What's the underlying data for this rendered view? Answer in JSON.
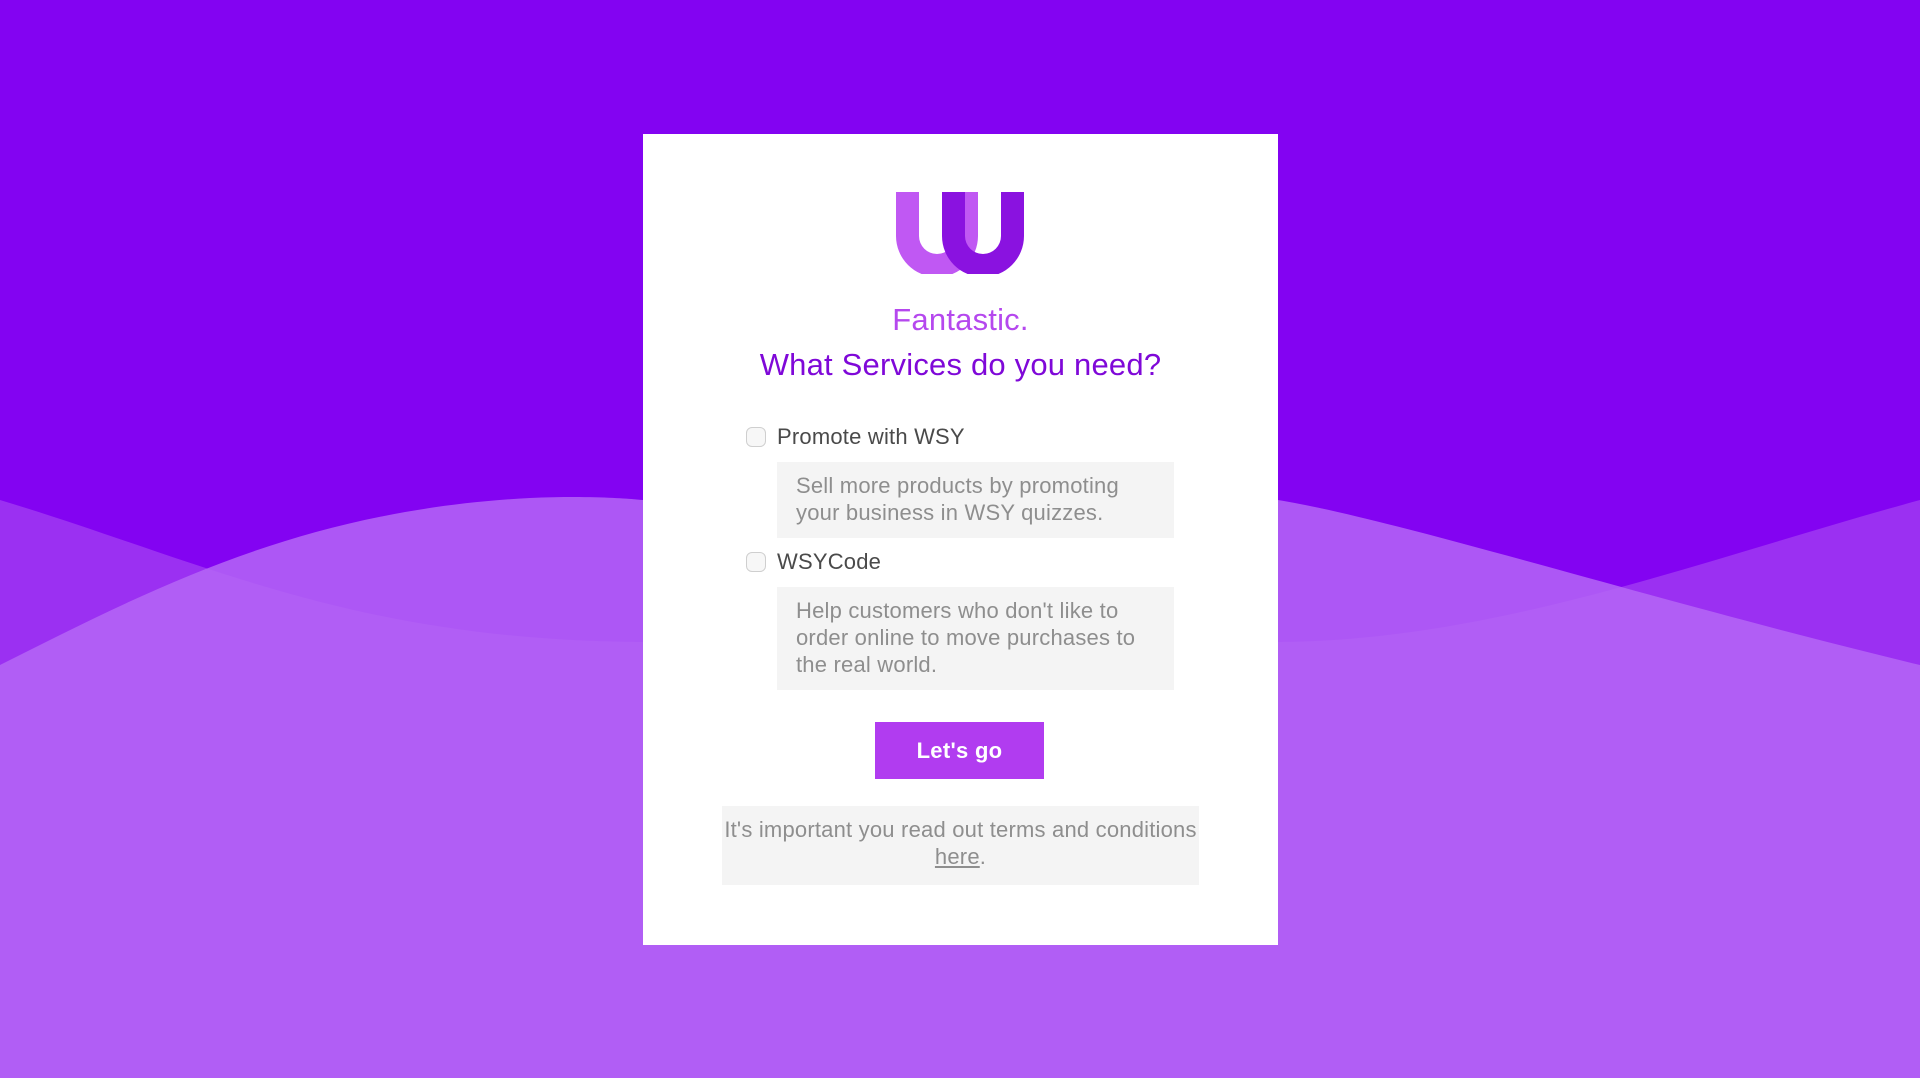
{
  "colors": {
    "background": "#8303f2",
    "wave_back": "#9b30f2",
    "wave_front": "#b566f6",
    "heading_light": "#b548ee",
    "heading_dark": "#7f08d8",
    "button": "#b13cf0"
  },
  "logo": {
    "icon": "w-logo-icon"
  },
  "heading": {
    "line1": "Fantastic.",
    "line2": "What Services do you need?"
  },
  "options": [
    {
      "label": "Promote with WSY",
      "description": "Sell more products by promoting your business in WSY quizzes.",
      "checked": false
    },
    {
      "label": "WSYCode",
      "description": "Help customers who don't like to order online to move purchases to the real world.",
      "checked": false
    }
  ],
  "cta": {
    "label": "Let's go"
  },
  "terms": {
    "text_before": "It's important you read out terms and conditions ",
    "link_text": "here",
    "text_after": "."
  }
}
